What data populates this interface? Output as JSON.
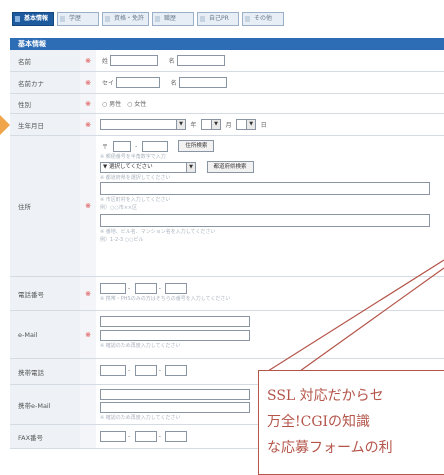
{
  "tabs": [
    {
      "label": "基本情報",
      "active": true
    },
    {
      "label": "学歴",
      "active": false
    },
    {
      "label": "資格・免許",
      "active": false
    },
    {
      "label": "職歴",
      "active": false
    },
    {
      "label": "自己PR",
      "active": false
    },
    {
      "label": "その他",
      "active": false
    }
  ],
  "section_title": "基本情報",
  "form": {
    "name": {
      "label": "名前",
      "req": "※",
      "sei": "姓",
      "mei": "名"
    },
    "kana": {
      "label": "名前カナ",
      "req": "※",
      "sei": "セイ",
      "mei": "名"
    },
    "gender": {
      "label": "性別",
      "req": "※",
      "options": "○ 男性　○ 女性"
    },
    "birth": {
      "label": "生年月日",
      "req": "※",
      "year": "年",
      "month": "月",
      "day": "日"
    },
    "address": {
      "label": "住所",
      "req": "※",
      "zip_mark": "〒",
      "search_btn": "住所検索",
      "hint1": "※ 郵便番号を半角数字で入力",
      "pref_select": "▼ 選択してください",
      "map_btn": "都道府県検索",
      "hint2": "※ 都道府県を選択してください",
      "hint3": "※ 市区町村を入力してください",
      "hint4": "例）○○市××区",
      "hint5": "※ 番地、ビル名、マンション名を入力してください",
      "hint6": "例）1-2-3 ○○ビル"
    },
    "phone": {
      "label": "電話番号",
      "req": "※",
      "hint": "※ 携帯・PHSのみの方はそちらの番号を入力してください"
    },
    "email": {
      "label": "e-Mail",
      "req": "※",
      "hint": "※ 確認のため再度入力してください"
    },
    "mobile": {
      "label": "携帯電話"
    },
    "mobile_mail": {
      "label": "携帯e-Mail",
      "hint": "※ 確認のため再度入力してください"
    },
    "fax": {
      "label": "FAX番号"
    }
  },
  "callout": {
    "line1": "SSL 対応だからセ",
    "line2": "万全!CGIの知識",
    "line3": "な応募フォームの利"
  },
  "colors": {
    "accent": "#2d6db5",
    "callout": "#b4554a",
    "arrow": "#f0a54a"
  }
}
